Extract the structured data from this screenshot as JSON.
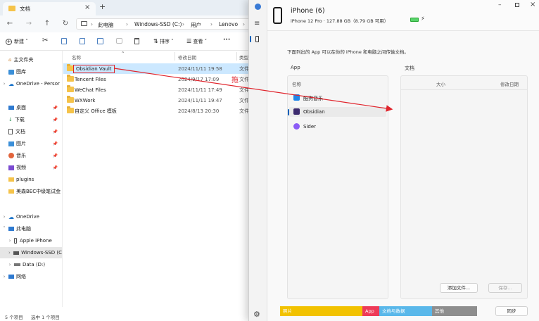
{
  "explorer": {
    "tab_title": "文档",
    "breadcrumb": [
      "此电脑",
      "Windows-SSD (C:)",
      "用户",
      "Lenovo"
    ],
    "toolbar": {
      "new_label": "新建",
      "sort_label": "排序",
      "view_label": "查看",
      "more_label": "···"
    },
    "columns": {
      "name": "名称",
      "date": "修改日期",
      "type": "类型"
    },
    "files": [
      {
        "name": "Obsidian Vault",
        "date": "2024/11/11 19:58",
        "type": "文件"
      },
      {
        "name": "Tencent Files",
        "date": "2024/9/17 17:09",
        "type": "文件"
      },
      {
        "name": "WeChat Files",
        "date": "2024/11/11 17:49",
        "type": "文件"
      },
      {
        "name": "WXWork",
        "date": "2024/11/11 19:47",
        "type": "文件"
      },
      {
        "name": "自定义 Office 模板",
        "date": "2024/8/13 20:30",
        "type": "文件"
      }
    ],
    "nav": {
      "home": "主文件夹",
      "gallery": "图库",
      "onedrive_personal": "OneDrive - Persor",
      "desktop": "桌面",
      "downloads": "下载",
      "documents": "文档",
      "pictures": "图片",
      "music": "音乐",
      "videos": "视频",
      "plugins": "plugins",
      "bec": "美森BEC中级笔试金",
      "onedrive": "OneDrive",
      "thispc": "此电脑",
      "iphone": "Apple iPhone",
      "cdrive": "Windows-SSD (C",
      "ddrive": "Data (D:)",
      "network": "网络"
    },
    "status": {
      "count": "5 个项目",
      "selected": "选中 1 个项目"
    }
  },
  "annotation": {
    "drag_label": "拖"
  },
  "devices": {
    "device_name": "iPhone (6)",
    "device_info": "iPhone 12 Pro · 127.88 GB（8.79 GB 可用）",
    "description": "下面列出的 App 可以在你的 iPhone 和电脑之间传输文档。",
    "apps_header": "App",
    "apps_col": "名称",
    "apps": [
      "酷狗音乐",
      "Obsidian",
      "Sider"
    ],
    "docs_header": "文档",
    "docs_cols": {
      "size": "大小",
      "modified": "修改日期"
    },
    "add_file": "添加文件...",
    "save": "保存...",
    "storage": [
      {
        "label": "照片",
        "color": "#f2c200"
      },
      {
        "label": "App",
        "color": "#ee3b58"
      },
      {
        "label": "文档与数据",
        "color": "#5ab8ea"
      },
      {
        "label": "其他",
        "color": "#8e8e8e"
      }
    ],
    "sync": "同步"
  },
  "colors": {
    "accent": "#005fb8",
    "annotation": "#e0242c"
  }
}
